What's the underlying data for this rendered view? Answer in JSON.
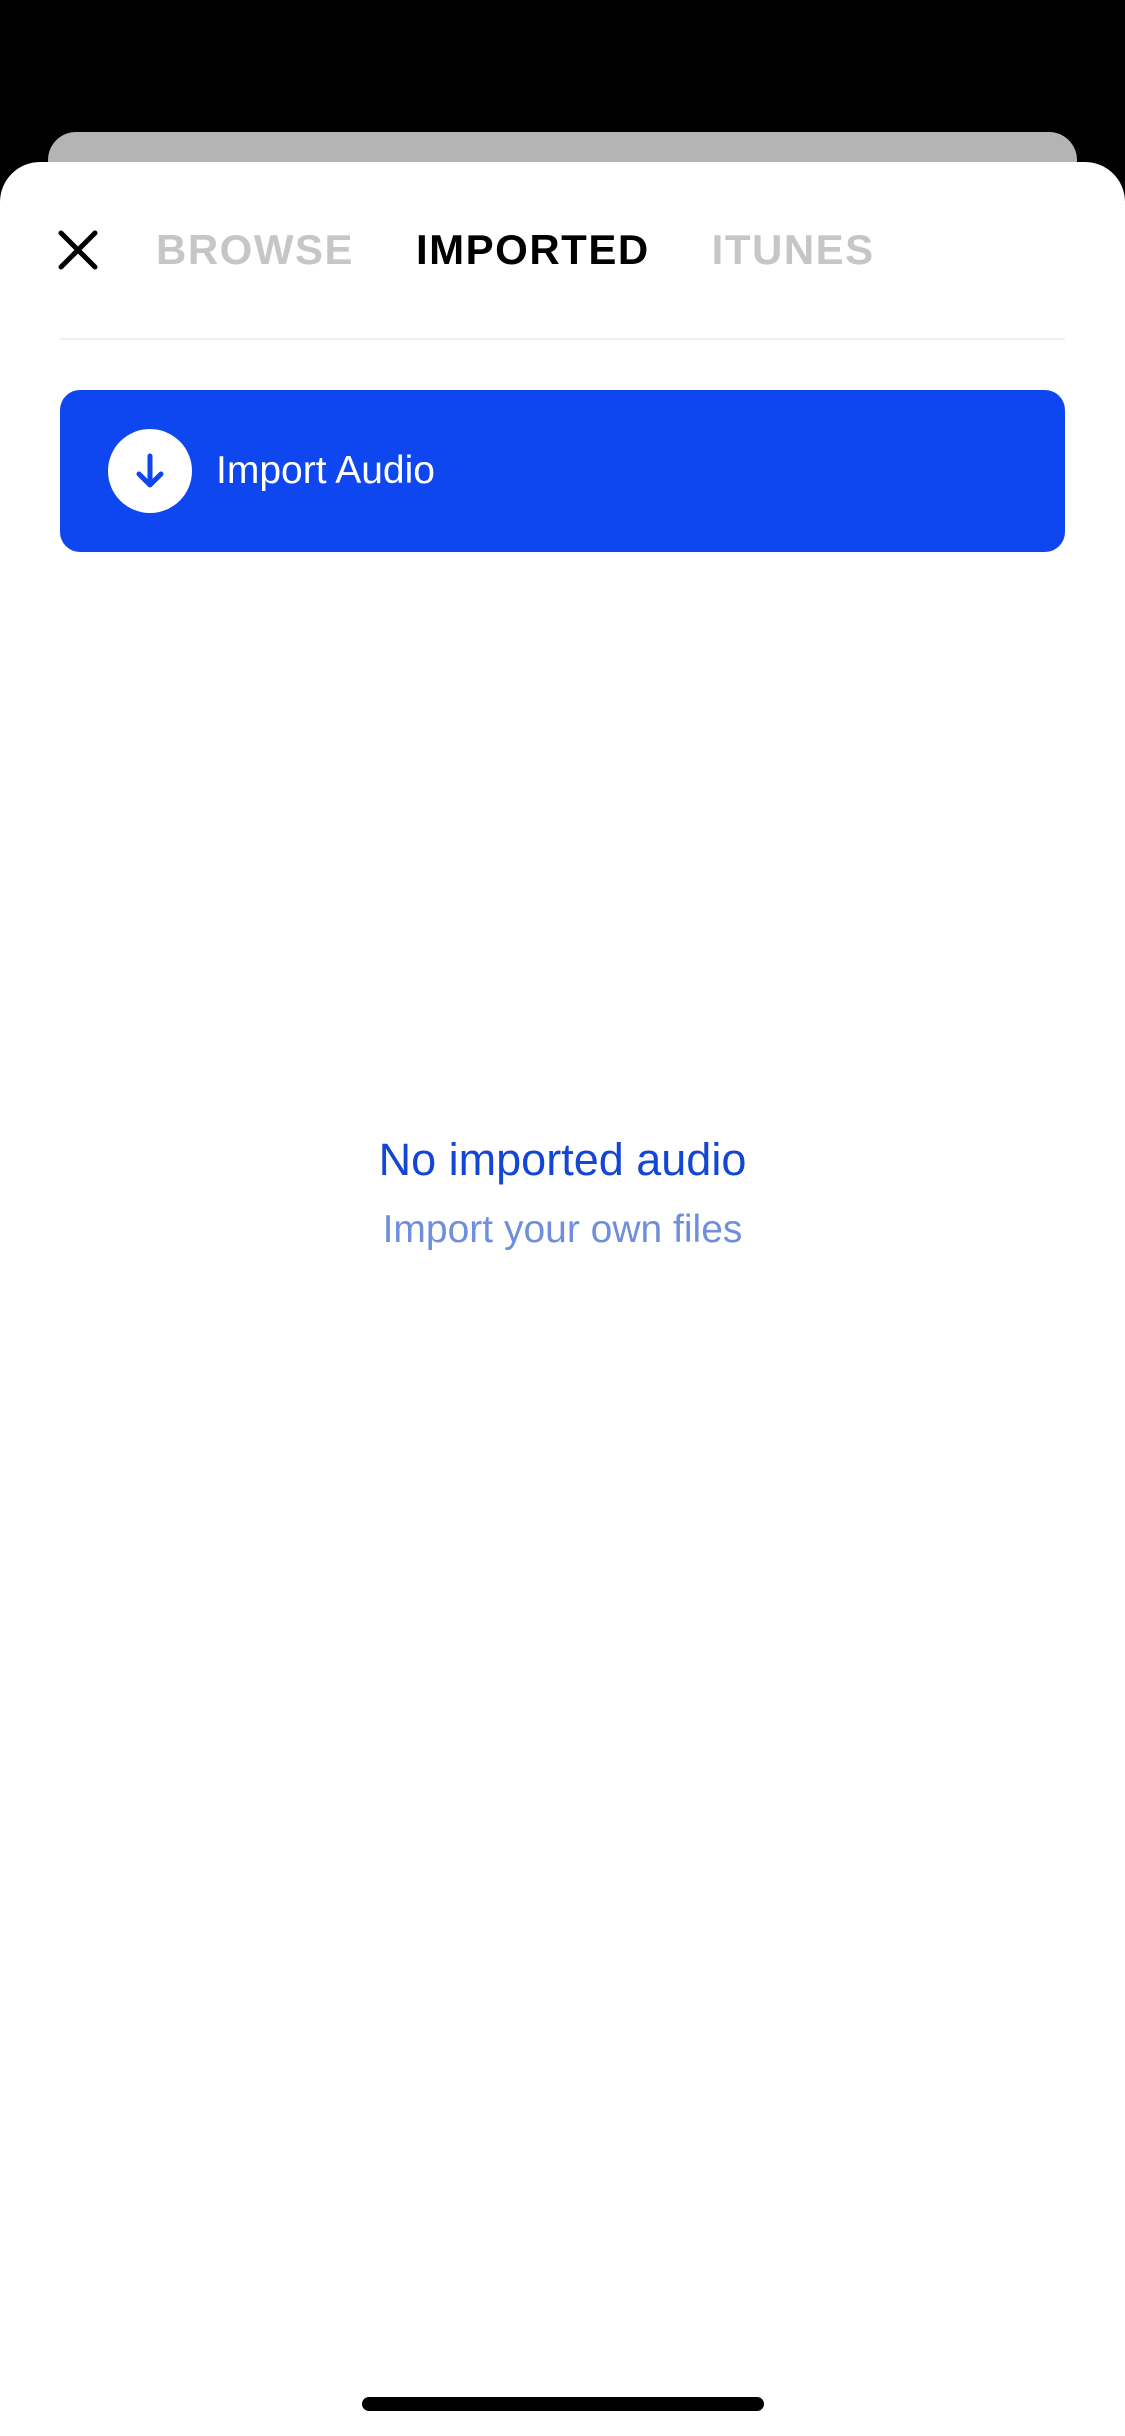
{
  "tabs": [
    {
      "label": "BROWSE",
      "active": false
    },
    {
      "label": "IMPORTED",
      "active": true
    },
    {
      "label": "ITUNES",
      "active": false
    }
  ],
  "import_button": {
    "label": "Import Audio",
    "icon": "arrow-down-icon"
  },
  "empty_state": {
    "title": "No imported audio",
    "subtitle": "Import your own files"
  },
  "colors": {
    "accent": "#0e46ef",
    "title_blue": "#1446d6",
    "subtitle_blue": "#6e8fdb",
    "inactive_tab": "#c6c6c6"
  }
}
